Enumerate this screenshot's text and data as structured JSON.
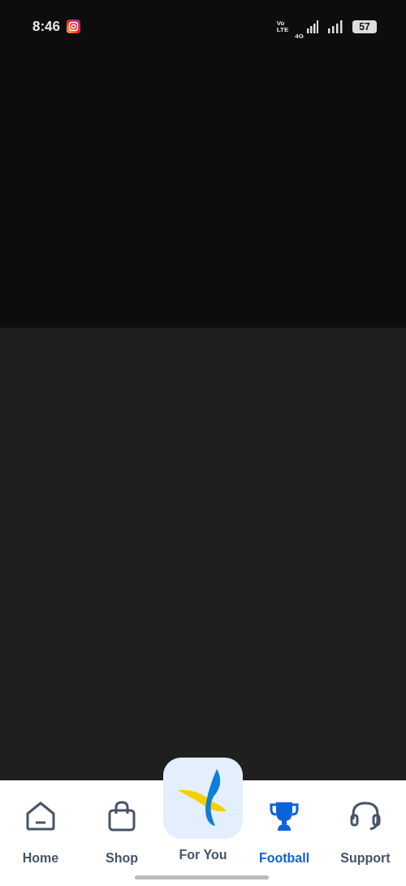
{
  "status_bar": {
    "time": "8:46",
    "network_1": "Vo",
    "network_2": "LTE",
    "network_3": "4G",
    "battery": "57"
  },
  "bottom_nav": [
    {
      "label": "Home",
      "kind": "home",
      "selected": false
    },
    {
      "label": "Shop",
      "kind": "shop",
      "selected": false
    },
    {
      "label": "For You",
      "kind": "featured",
      "selected": false
    },
    {
      "label": "Football",
      "kind": "trophy",
      "selected": true
    },
    {
      "label": "Support",
      "kind": "support",
      "selected": false
    }
  ]
}
